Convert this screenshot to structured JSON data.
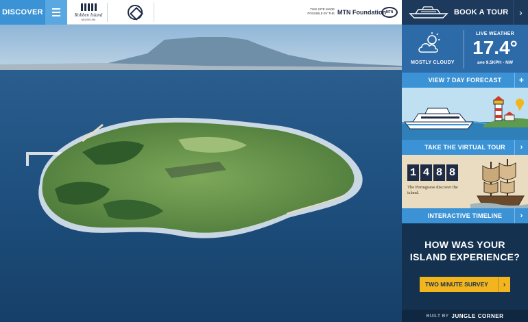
{
  "nav": {
    "discover_label": "DISCOVER",
    "logo_text": "Robben Island",
    "logo_sub": "MUSEUM",
    "sponsor_text": "THIS SITE MADE POSSIBLE BY THE",
    "sponsor_name": "MTN Foundation",
    "sponsor_logo": "MTN"
  },
  "sidebar": {
    "book_tour_label": "BOOK A TOUR",
    "weather": {
      "condition": "MOSTLY CLOUDY",
      "live_label": "LIVE WEATHER",
      "temperature": "17.4°",
      "wind": "ave 9.5KPH - NW"
    },
    "forecast_label": "VIEW 7 DAY FORECAST",
    "virtual_tour_label": "TAKE THE VIRTUAL TOUR",
    "timeline": {
      "digits": [
        "1",
        "4",
        "8",
        "8"
      ],
      "caption": "The Portuguese discover the island.",
      "label": "INTERACTIVE TIMELINE"
    },
    "survey": {
      "question_line1": "HOW WAS YOUR",
      "question_line2": "ISLAND EXPERIENCE?",
      "button_label": "TWO MINUTE SURVEY"
    },
    "footer": {
      "built_by": "BUILT BY",
      "agency": "JUNGLE CORNER"
    }
  },
  "colors": {
    "accent_blue": "#3b93d6",
    "sidebar_navy": "#14324f",
    "survey_yellow": "#f2b51d",
    "weather_blue": "#2d6aa8"
  }
}
